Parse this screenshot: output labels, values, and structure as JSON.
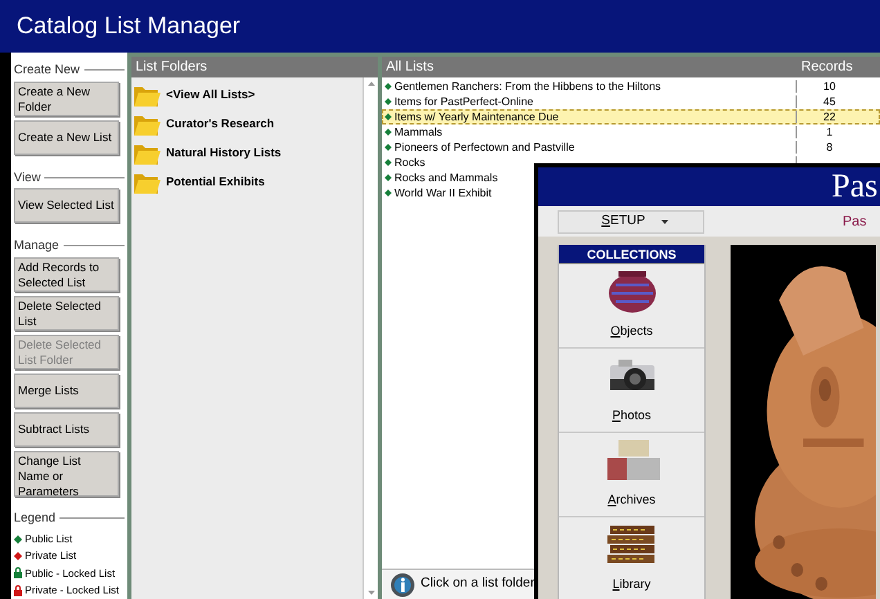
{
  "window": {
    "title": "Catalog List Manager"
  },
  "sidebar": {
    "sections": [
      {
        "heading": "Create New",
        "buttons": [
          {
            "label": "Create a New Folder",
            "disabled": false
          },
          {
            "label": "Create a New List",
            "disabled": false
          }
        ]
      },
      {
        "heading": "View",
        "buttons": [
          {
            "label": "View Selected List",
            "disabled": false
          }
        ]
      },
      {
        "heading": "Manage",
        "buttons": [
          {
            "label": "Add Records to Selected List",
            "disabled": false
          },
          {
            "label": "Delete Selected List",
            "disabled": false
          },
          {
            "label": "Delete Selected List Folder",
            "disabled": true
          },
          {
            "label": "Merge Lists",
            "disabled": false
          },
          {
            "label": "Subtract Lists",
            "disabled": false
          },
          {
            "label": "Change List Name or Parameters",
            "disabled": false
          }
        ]
      }
    ],
    "legend": {
      "heading": "Legend",
      "items": [
        {
          "label": "Public List",
          "kind": "diamond",
          "color": "#16803a"
        },
        {
          "label": "Private List",
          "kind": "diamond",
          "color": "#d01818"
        },
        {
          "label": "Public - Locked List",
          "kind": "lock",
          "color": "#16803a"
        },
        {
          "label": "Private - Locked List",
          "kind": "lock",
          "color": "#d01818"
        }
      ]
    }
  },
  "folders": {
    "header": "List Folders",
    "items": [
      {
        "label": "<View All Lists>"
      },
      {
        "label": "Curator's Research"
      },
      {
        "label": "Natural History Lists"
      },
      {
        "label": "Potential Exhibits"
      }
    ]
  },
  "lists": {
    "header": "All Lists",
    "records_header": "Records",
    "rows": [
      {
        "name": "Gentlemen Ranchers: From the Hibbens to the Hiltons",
        "records": "10",
        "selected": false
      },
      {
        "name": "Items for PastPerfect-Online",
        "records": "45",
        "selected": false
      },
      {
        "name": "Items w/ Yearly Maintenance Due",
        "records": "22",
        "selected": true
      },
      {
        "name": "Mammals",
        "records": "1",
        "selected": false
      },
      {
        "name": "Pioneers of Perfectown and Pastville",
        "records": "8",
        "selected": false
      },
      {
        "name": "Rocks",
        "selected": false
      },
      {
        "name": "Rocks and Mammals",
        "selected": false
      },
      {
        "name": "World War II Exhibit",
        "selected": false
      }
    ]
  },
  "status": "Click on a list folder",
  "overlay": {
    "title": "Pas",
    "menu": {
      "label": "SETUP"
    },
    "subtitle": "Pas",
    "collections": {
      "header": "COLLECTIONS",
      "items": [
        {
          "label": "Objects",
          "kind": "vase"
        },
        {
          "label": "Photos",
          "kind": "camera"
        },
        {
          "label": "Archives",
          "kind": "boxes"
        },
        {
          "label": "Library",
          "kind": "books"
        }
      ]
    }
  }
}
